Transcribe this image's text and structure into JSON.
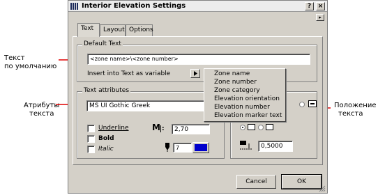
{
  "dialog": {
    "title": "Interior Elevation Settings",
    "help_button": "?",
    "close_button": "×",
    "arrow_button": "▸"
  },
  "tabs": [
    {
      "label": "Text",
      "active": true
    },
    {
      "label": "Layout",
      "active": false
    },
    {
      "label": "Options",
      "active": false
    }
  ],
  "default_text": {
    "group_title": "Default Text",
    "field_value": "<zone name>\\<zone number>",
    "insert_label": "Insert into Text as variable"
  },
  "variable_menu": {
    "items": [
      "Zone name",
      "Zone number",
      "Zone category",
      "Elevation orientation",
      "Elevation number",
      "Elevation marker text"
    ]
  },
  "text_attributes": {
    "group_title": "Text attributes",
    "font": "MS UI Gothic Greek",
    "underline_label": "Underline",
    "bold_label": "Bold",
    "italic_label": "Italic",
    "size_value": "2,70",
    "pen_value": "7",
    "pen_color": "#0000cc"
  },
  "position": {
    "offset_value": "0,5000"
  },
  "footer": {
    "cancel_label": "Cancel",
    "ok_label": "OK"
  },
  "annotations": {
    "default_text": [
      "Текст",
      "по умолчанию"
    ],
    "attributes": [
      "Атрибуты",
      "текста"
    ],
    "position": [
      "Положение",
      "текста"
    ],
    "arrow_color": "#e00000"
  }
}
